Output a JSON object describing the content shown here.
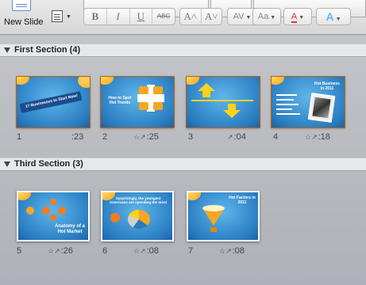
{
  "toolbar": {
    "new_slide_label": "New Slide",
    "format_buttons": [
      "B",
      "I",
      "U",
      "ABC"
    ],
    "size_buttons": [
      "A˄",
      "A˅"
    ],
    "spacing_button": "AV",
    "aa_button": "Aa",
    "font_color_button": "A",
    "text_effects_button": "A"
  },
  "sections": [
    {
      "name": "First Section (4)",
      "slides": [
        {
          "number": "1",
          "meta": ":23",
          "icons": "",
          "title": "17 Businesses to Start Now!",
          "selected": true
        },
        {
          "number": "2",
          "meta": ":25",
          "icons": "☆↗",
          "title": "How to Spot Hot Trends",
          "selected": true
        },
        {
          "number": "3",
          "meta": ":04",
          "icons": "↗",
          "title": "",
          "selected": true
        },
        {
          "number": "4",
          "meta": ":18",
          "icons": "☆↗",
          "title": "Hot Business in 2011",
          "selected": true
        }
      ]
    },
    {
      "name": "Third Section (3)",
      "slides": [
        {
          "number": "5",
          "meta": ":26",
          "icons": "☆↗",
          "title": "Anatomy of a Hot Market",
          "selected": false
        },
        {
          "number": "6",
          "meta": ":08",
          "icons": "☆↗",
          "title": "Surprisingly, the youngest Americans are spending the most",
          "selected": false
        },
        {
          "number": "7",
          "meta": ":08",
          "icons": "☆↗",
          "title": "Hot Factors in 2011",
          "selected": false
        }
      ]
    }
  ],
  "colors": {
    "selection": "#f08a24",
    "slide_blue": "#2a7ec3",
    "accent_orange": "#f5a623"
  }
}
